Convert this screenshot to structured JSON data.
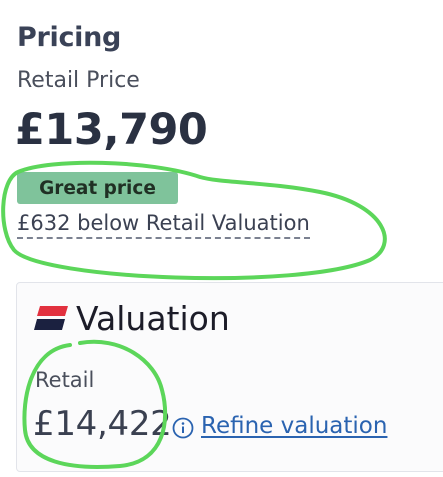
{
  "pricing": {
    "title": "Pricing",
    "retail_price_label": "Retail Price",
    "price": "£13,790",
    "badge": "Great price",
    "below_text": "£632 below Retail Valuation"
  },
  "valuation": {
    "logo_text": "Valuation",
    "retail_label": "Retail",
    "retail_price": "£14,422",
    "refine_link": "Refine valuation"
  },
  "colors": {
    "badge_bg": "#7fc39b",
    "link": "#2a63b0",
    "logo_red": "#e2313f",
    "logo_navy": "#1b2140",
    "annotation_green": "#5cd65a"
  },
  "icons": [
    "valuation-logo-mark",
    "info-icon"
  ]
}
